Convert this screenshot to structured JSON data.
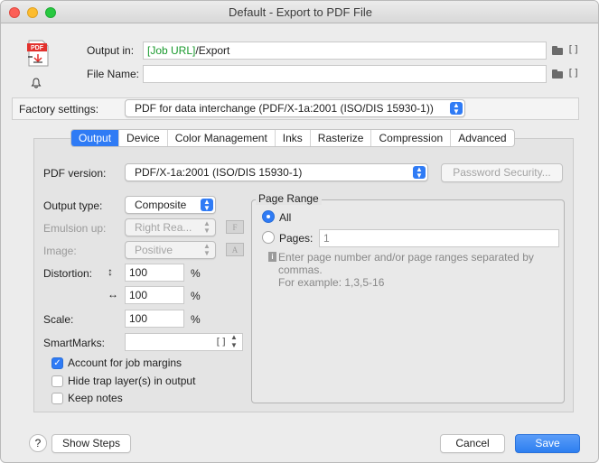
{
  "window": {
    "title": "Default - Export to PDF File"
  },
  "top": {
    "output_in_label": "Output in:",
    "output_in_prefix": "[Job URL]",
    "output_in_suffix": "/Export",
    "file_name_label": "File Name:",
    "file_name_value": "",
    "pdf_icon_text": "PDF"
  },
  "factory": {
    "label": "Factory settings:",
    "value": "PDF for data interchange (PDF/X-1a:2001 (ISO/DIS 15930-1))"
  },
  "tabs": [
    "Output",
    "Device",
    "Color Management",
    "Inks",
    "Rasterize",
    "Compression",
    "Advanced"
  ],
  "pdf_version": {
    "label": "PDF version:",
    "value": "PDF/X-1a:2001 (ISO/DIS 15930-1)"
  },
  "password_button": "Password Security...",
  "output_type": {
    "label": "Output type:",
    "value": "Composite"
  },
  "emulsion": {
    "label": "Emulsion up:",
    "value": "Right Rea..."
  },
  "image": {
    "label": "Image:",
    "value": "Positive"
  },
  "distortion": {
    "label": "Distortion:",
    "vertical": "100",
    "horizontal": "100",
    "unit": "%"
  },
  "scale": {
    "label": "Scale:",
    "value": "100",
    "unit": "%"
  },
  "smartmarks": {
    "label": "SmartMarks:",
    "value": ""
  },
  "checkboxes": [
    {
      "label": "Account for job margins",
      "checked": true
    },
    {
      "label": "Hide trap layer(s) in output",
      "checked": false
    },
    {
      "label": "Keep notes",
      "checked": false
    }
  ],
  "page_range": {
    "title": "Page Range",
    "all_label": "All",
    "pages_label": "Pages:",
    "pages_value": "1",
    "hint_line1": "Enter page number and/or page ranges separated by",
    "hint_line2": "commas.",
    "hint_line3": "For example: 1,3,5-16"
  },
  "footer": {
    "help": "?",
    "show_steps": "Show Steps",
    "cancel": "Cancel",
    "save": "Save"
  },
  "colors": {
    "accent": "#2f7bf5",
    "green_text": "#1a9a2e",
    "pdf_red": "#e2312d"
  }
}
